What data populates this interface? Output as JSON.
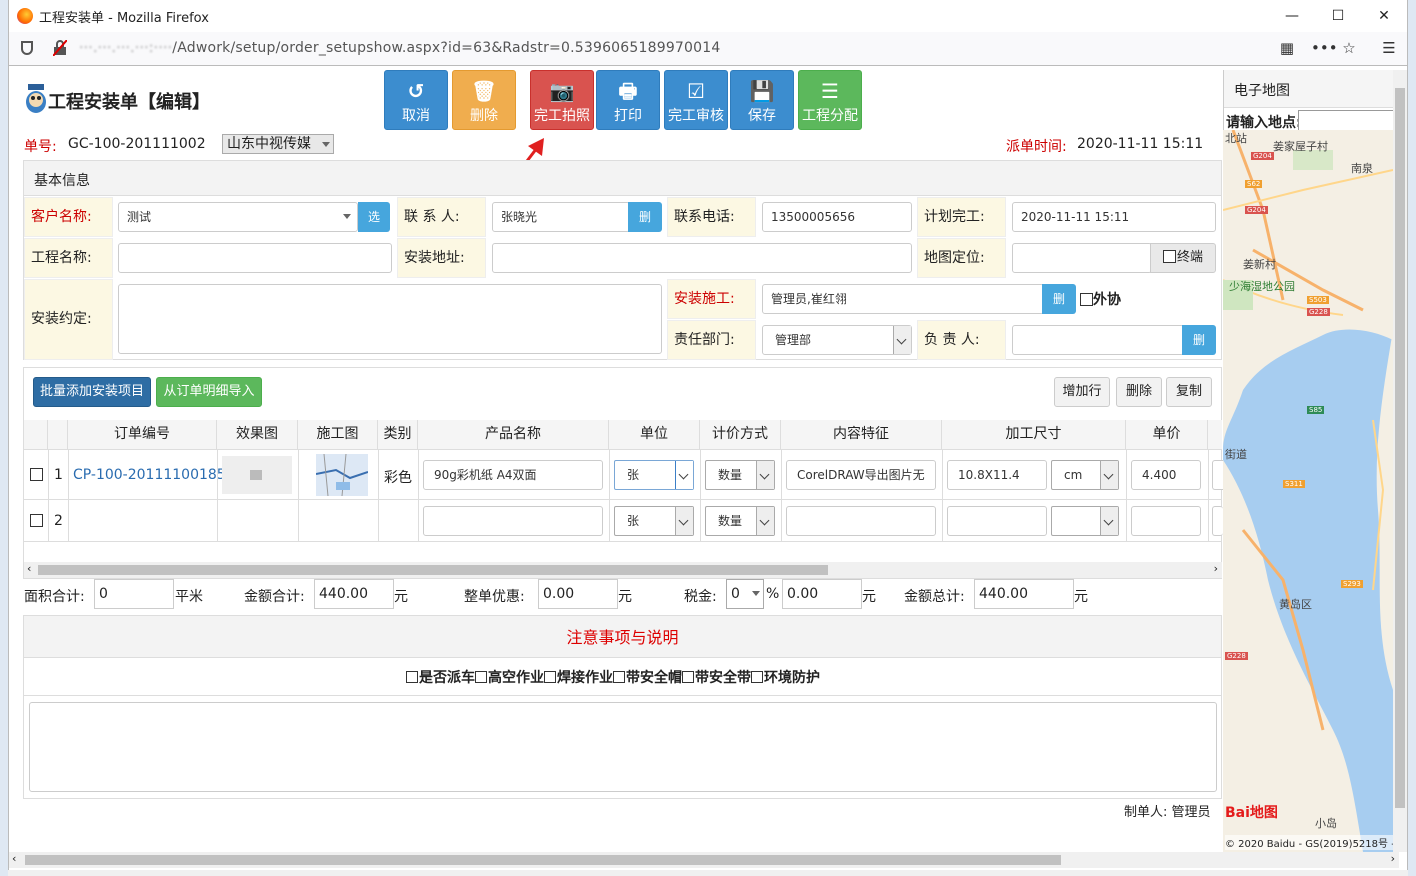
{
  "window": {
    "title": "工程安装单 - Mozilla Firefox",
    "url_hidden": "···.···.···.···:····",
    "url_path": "/Adwork/setup/order_setupshow.aspx?id=63&Radstr=0.5396065189970014"
  },
  "header": {
    "title": "工程安装单【编辑】"
  },
  "toolbar": [
    {
      "label": "取消",
      "icon": "↺",
      "color": "blue"
    },
    {
      "label": "删除",
      "icon": "🗑",
      "color": "orange"
    },
    {
      "label": "完工拍照",
      "icon": "📷",
      "color": "red"
    },
    {
      "label": "打印",
      "icon": "🖶",
      "color": "blue"
    },
    {
      "label": "完工审核",
      "icon": "☑",
      "color": "blue"
    },
    {
      "label": "保存",
      "icon": "💾",
      "color": "blue"
    },
    {
      "label": "工程分配",
      "icon": "☰",
      "color": "green"
    }
  ],
  "order": {
    "no_label": "单号:",
    "no_value": "GC-100-201111002",
    "company": "山东中视传媒",
    "dispatch_label": "派单时间:",
    "dispatch_value": "2020-11-11 15:11"
  },
  "basic": {
    "section_title": "基本信息",
    "customer_label": "客户名称:",
    "customer_value": "测试",
    "select_btn": "选",
    "contact_label": "联 系 人:",
    "contact_value": "张晓光",
    "del_btn": "删",
    "phone_label": "联系电话:",
    "phone_value": "13500005656",
    "plan_label": "计划完工:",
    "plan_value": "2020-11-11 15:11",
    "project_label": "工程名称:",
    "project_value": "",
    "address_label": "安装地址:",
    "address_value": "",
    "geo_label": "地图定位:",
    "terminal_label": "终端",
    "agreement_label": "安装约定:",
    "installer_label": "安装施工:",
    "installer_value": "管理员,崔红翎",
    "outsource_label": "外协",
    "dept_label": "责任部门:",
    "dept_value": "管理部",
    "owner_label": "负 责 人:"
  },
  "actions": {
    "batch_add": "批量添加安装项目",
    "import": "从订单明细导入",
    "add_row": "增加行",
    "delete": "删除",
    "copy": "复制"
  },
  "table": {
    "headers": [
      "订单编号",
      "效果图",
      "施工图",
      "类别",
      "产品名称",
      "单位",
      "计价方式",
      "内容特征",
      "加工尺寸",
      "单价"
    ],
    "rows": [
      {
        "idx": "1",
        "order_no": "CP-100-20111100185",
        "category": "彩色",
        "product": "90g彩机纸 A4双面",
        "unit": "张",
        "pricing": "数量",
        "feature": "CorelDRAW导出图片无",
        "size": "10.8X11.4",
        "size_unit": "cm",
        "price": "4.400"
      },
      {
        "idx": "2",
        "order_no": "",
        "category": "",
        "product": "",
        "unit": "张",
        "pricing": "数量",
        "feature": "",
        "size": "",
        "size_unit": "",
        "price": ""
      }
    ]
  },
  "totals": {
    "area_label": "面积合计:",
    "area_value": "0",
    "area_unit": "平米",
    "amount_label": "金额合计:",
    "amount_value": "440.00",
    "amount_unit": "元",
    "discount_label": "整单优惠:",
    "discount_value": "0.00",
    "discount_unit": "元",
    "tax_label": "税金:",
    "tax_rate": "0",
    "tax_pct": "%",
    "tax_value": "0.00",
    "tax_unit": "元",
    "total_label": "金额总计:",
    "total_value": "440.00",
    "total_unit": "元"
  },
  "notes": {
    "title": "注意事项与说明",
    "options": [
      "是否派车",
      "高空作业",
      "焊接作业",
      "带安全帽",
      "带安全带",
      "环境防护"
    ]
  },
  "footer": {
    "creator_label": "制单人:",
    "creator_value": "管理员"
  },
  "map": {
    "title": "电子地图",
    "search_label": "请输入地点:",
    "labels": [
      "北站",
      "姜家屋子村",
      "南泉",
      "姜新村",
      "少海湿地公园",
      "黄岛区",
      "小岛",
      "街道"
    ],
    "road_tags": [
      "G204",
      "S62",
      "G204",
      "S503",
      "G228",
      "S85",
      "S311",
      "S293",
      "G228"
    ],
    "logo": "Bai地图",
    "copyright": "© 2020 Baidu - GS(2019)5218号 -"
  },
  "colors": {
    "accent_blue": "#3c8dcf",
    "danger": "#d9534f",
    "warning": "#f0ad4e",
    "success": "#5cb85c",
    "label_red": "#cc0000"
  }
}
